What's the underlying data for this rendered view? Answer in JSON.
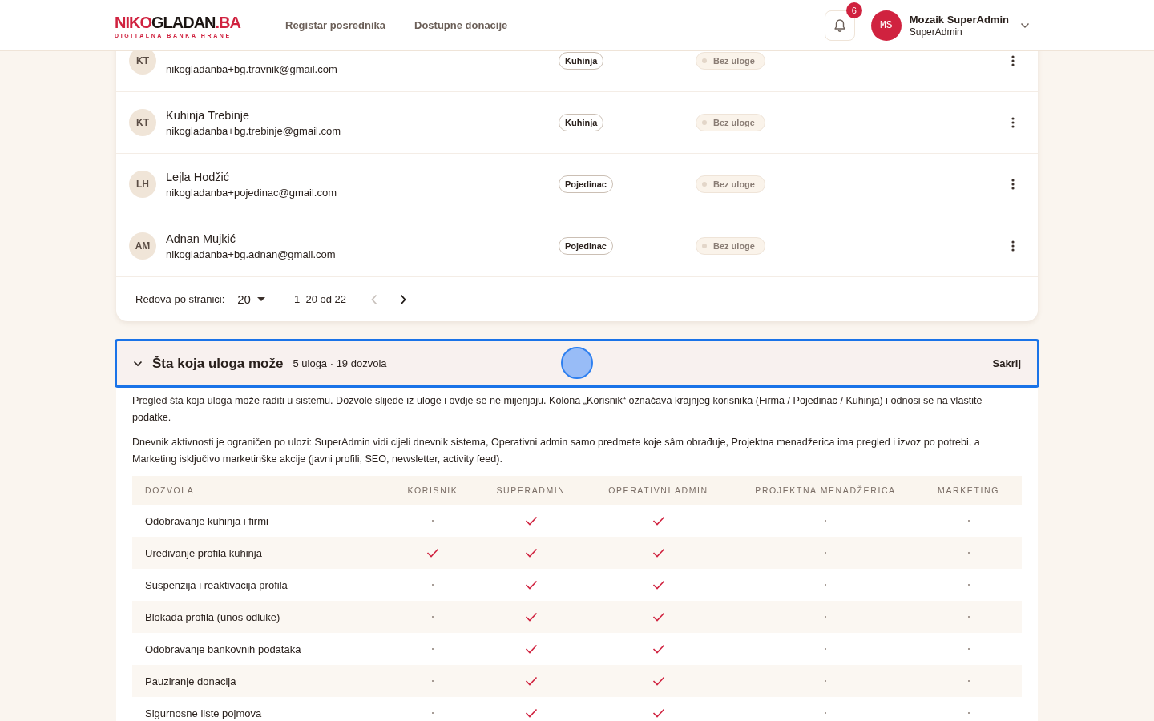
{
  "header": {
    "logo": [
      {
        "text": "NIKO",
        "accent": true
      },
      {
        "text": "GLADAN",
        "accent": false
      },
      {
        "text": ".BA",
        "accent": true
      }
    ],
    "logo_tagline": "DIGITALNA BANKA HRANE",
    "nav": [
      {
        "label": "Registar posrednika"
      },
      {
        "label": "Dostupne donacije"
      }
    ],
    "notifications": {
      "count": "6"
    },
    "user": {
      "initials": "MS",
      "name": "Mozaik SuperAdmin",
      "role": "SuperAdmin"
    }
  },
  "users": [
    {
      "initials": "KT",
      "email": "nikogladanba+bg.travnik@gmail.com",
      "type": "Kuhinja",
      "role": "Bez uloge"
    },
    {
      "initials": "KT",
      "name": "Kuhinja Trebinje",
      "email": "nikogladanba+bg.trebinje@gmail.com",
      "type": "Kuhinja",
      "role": "Bez uloge"
    },
    {
      "initials": "LH",
      "name": "Lejla Hodžić",
      "email": "nikogladanba+pojedinac@gmail.com",
      "type": "Pojedinac",
      "role": "Bez uloge"
    },
    {
      "initials": "AM",
      "name": "Adnan Mujkić",
      "email": "nikogladanba+bg.adnan@gmail.com",
      "type": "Pojedinac",
      "role": "Bez uloge"
    }
  ],
  "pagination": {
    "label": "Redova po stranici:",
    "page_size": "20",
    "range": "1–20 od 22",
    "prev_disabled": true,
    "next_disabled": false
  },
  "roles_section": {
    "title": "Šta koja uloga može",
    "summary": "5 uloga · 19 dozvola",
    "toggle": "Sakrij",
    "expanded": true,
    "paragraphs": [
      "Pregled šta koja uloga može raditi u sistemu. Dozvole slijede iz uloge i ovdje se ne mijenjaju. Kolona „Korisnik“ označava krajnjeg korisnika (Firma / Pojedinac / Kuhinja) i odnosi se na vlastite podatke.",
      "Dnevnik aktivnosti je ograničen po ulozi: SuperAdmin vidi cijeli dnevnik sistema, Operativni admin samo predmete koje sâm obrađuje, Projektna menadžerica ima pregled i izvoz po potrebi, a Marketing isključivo marketinške akcije (javni profili, SEO, newsletter, activity feed)."
    ],
    "columns": [
      "DOZVOLA",
      "KORISNIK",
      "SUPERADMIN",
      "OPERATIVNI ADMIN",
      "PROJEKTNA MENADŽERICA",
      "MARKETING"
    ],
    "rows": [
      {
        "permission": "Odobravanje kuhinja i firmi",
        "allowed": [
          false,
          true,
          true,
          false,
          false
        ]
      },
      {
        "permission": "Uređivanje profila kuhinja",
        "allowed": [
          true,
          true,
          true,
          false,
          false
        ]
      },
      {
        "permission": "Suspenzija i reaktivacija profila",
        "allowed": [
          false,
          true,
          true,
          false,
          false
        ]
      },
      {
        "permission": "Blokada profila (unos odluke)",
        "allowed": [
          false,
          true,
          true,
          false,
          false
        ]
      },
      {
        "permission": "Odobravanje bankovnih podataka",
        "allowed": [
          false,
          true,
          true,
          false,
          false
        ]
      },
      {
        "permission": "Pauziranje donacija",
        "allowed": [
          false,
          true,
          true,
          false,
          false
        ]
      },
      {
        "permission": "Sigurnosne liste pojmova",
        "allowed": [
          false,
          true,
          true,
          false,
          false
        ]
      }
    ]
  }
}
